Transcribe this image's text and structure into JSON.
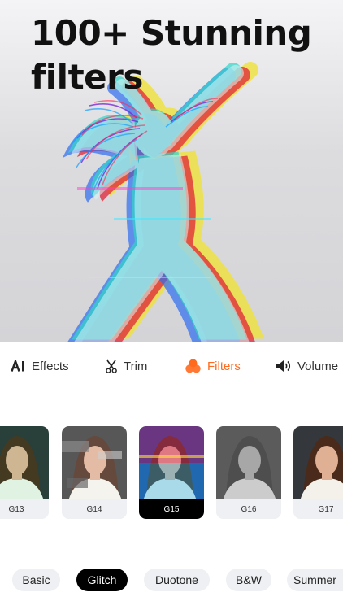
{
  "hero": {
    "title_line1": "100+ Stunning",
    "title_line2": "filters"
  },
  "tools": [
    {
      "label": "Effects",
      "icon": "ai-effects-icon"
    },
    {
      "label": "Trim",
      "icon": "scissors-icon"
    },
    {
      "label": "Filters",
      "icon": "filters-icon",
      "active": true
    },
    {
      "label": "Volume",
      "icon": "volume-icon"
    }
  ],
  "filters": [
    {
      "label": "G13"
    },
    {
      "label": "G14"
    },
    {
      "label": "G15",
      "selected": true
    },
    {
      "label": "G16"
    },
    {
      "label": "G17"
    }
  ],
  "categories": [
    {
      "label": "Basic"
    },
    {
      "label": "Glitch",
      "active": true
    },
    {
      "label": "Duotone"
    },
    {
      "label": "B&W"
    },
    {
      "label": "Summer"
    }
  ],
  "colors": {
    "accent": "#ff6a1f",
    "selected": "#000000",
    "pill_bg": "#eef0f3"
  }
}
